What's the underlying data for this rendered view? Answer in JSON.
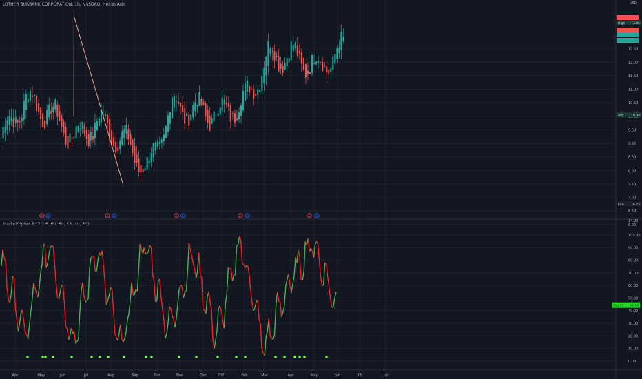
{
  "header": {
    "symbol_line": "LUTHER BURBANK CORPORATION, 1h, NASDAQ, Heikin Ashi",
    "currency": "USD"
  },
  "oscillator": {
    "title": "MarketCipher B (2.2.6, 60, 60, 53, 40, 53)",
    "axis_ticks": [
      "100.00",
      "90.00",
      "80.00",
      "70.00",
      "60.00",
      "50.00",
      "40.00",
      "30.00",
      "20.00",
      "10.00",
      "0.00"
    ],
    "current_label": "44.44",
    "current_label_prefix": "Osc 53"
  },
  "price_axis": {
    "ticks": [
      "12.50",
      "12.00",
      "11.50",
      "11.00",
      "10.50",
      "10.00",
      "9.50",
      "9.00",
      "8.50",
      "8.00",
      "7.50",
      "7.00",
      "6.50",
      "6.00"
    ],
    "top_partial": "14.00"
  },
  "price_labels": {
    "high_label": "High",
    "high_value": "13.45",
    "avg_label": "Avg",
    "avg_value": "10.04",
    "low_label": "Low",
    "low_value": "6.75"
  },
  "event_markers": {
    "letters": [
      "E",
      "D"
    ]
  },
  "time_axis": {
    "labels": [
      "Apr",
      "May",
      "Jun",
      "Jul",
      "Aug",
      "Sep",
      "Oct",
      "Nov",
      "Dec",
      "2021",
      "Feb",
      "Mar",
      "Apr",
      "May",
      "Jun",
      "15",
      "Jul"
    ]
  },
  "colors": {
    "background": "#131722",
    "up": "#26a69a",
    "down": "#ef5350",
    "osc_green": "#4caf50",
    "osc_red": "#ff1c1c",
    "trendline": "#e8a391",
    "dot_green": "#66ff33"
  },
  "chart_data": [
    {
      "type": "line",
      "title": "LUTHER BURBANK CORPORATION, 1h, NASDAQ, Heikin Ashi",
      "ylabel": "USD",
      "ylim": [
        6.5,
        14.0
      ],
      "x": [
        "Apr",
        "May",
        "Jun",
        "Jul",
        "Aug",
        "Sep",
        "Oct",
        "Nov",
        "Dec",
        "2021",
        "Feb",
        "Mar",
        "Apr",
        "May",
        "Jun"
      ],
      "series": [
        {
          "name": "Heikin Ashi close (approx.)",
          "values": [
            9.2,
            10.6,
            10.1,
            9.2,
            9.8,
            9.1,
            8.0,
            10.4,
            10.2,
            10.1,
            10.6,
            12.3,
            12.2,
            11.8,
            12.5
          ]
        }
      ],
      "trendlines": [
        {
          "from": [
            "Jul",
            10.0
          ],
          "to": [
            "Jun",
            13.9
          ]
        },
        {
          "from": [
            "Sep",
            7.5
          ],
          "to": [
            "Jun",
            13.7
          ]
        }
      ],
      "labels": {
        "high": 13.45,
        "average": 10.04,
        "low": 6.75
      }
    },
    {
      "type": "line",
      "title": "MarketCipher B (2.2.6, 60, 60, 53, 40, 53)",
      "ylim": [
        0,
        100
      ],
      "x": [
        "Apr",
        "May",
        "Jun",
        "Jul",
        "Aug",
        "Sep",
        "Oct",
        "Nov",
        "Dec",
        "2021",
        "Feb",
        "Mar",
        "Apr",
        "May",
        "Jun"
      ],
      "series": [
        {
          "name": "MarketCipher B",
          "values": [
            80,
            20,
            95,
            15,
            90,
            10,
            95,
            25,
            85,
            20,
            95,
            10,
            60,
            95,
            44.44
          ]
        }
      ]
    }
  ]
}
